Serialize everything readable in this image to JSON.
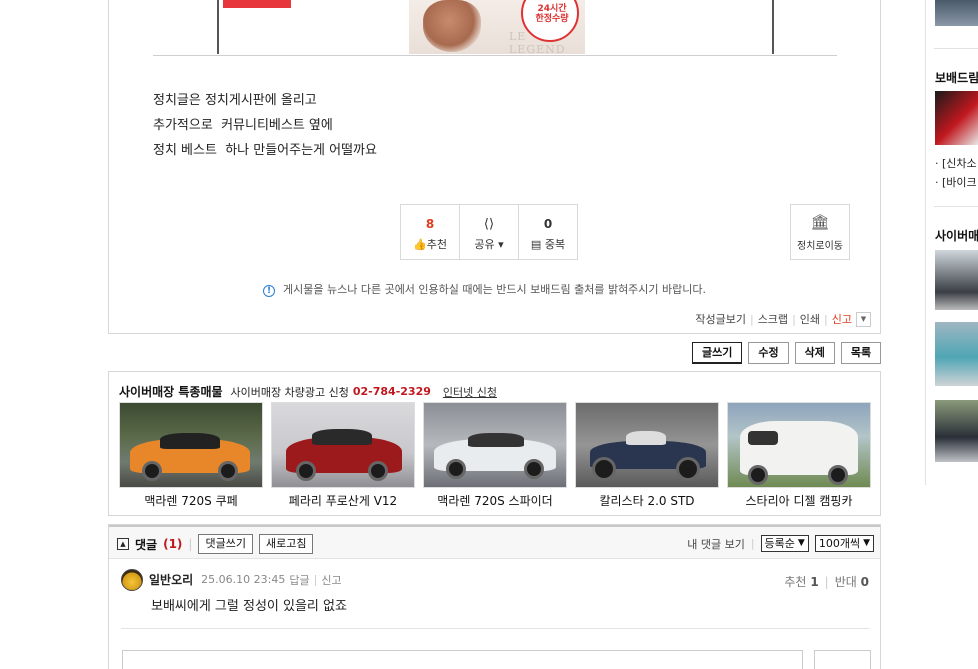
{
  "article": {
    "image_badge_line1": "24시간",
    "image_badge_line2": "한정수량",
    "image_legend_1": "LE",
    "image_legend_2": "LEGEND",
    "lines": [
      "정치글은 정치게시판에 올리고",
      "추가적으로  커뮤니티베스트 옆에",
      "정치 베스트  하나 만들어주는게 어떨까요"
    ],
    "votes": {
      "recommend_count": "8",
      "recommend_label": "추천",
      "share_label": "공유",
      "duplicate_count": "0",
      "duplicate_label": "중복"
    },
    "politics_move_label": "정치로이동",
    "notice": "게시물을 뉴스나 다른 곳에서 인용하실 때에는 반드시 보배드림 출처를 밝혀주시기 바랍니다.",
    "util_links": {
      "my_posts": "작성글보기",
      "scrap": "스크랩",
      "print": "인쇄",
      "report": "신고"
    }
  },
  "write_buttons": {
    "write": "글쓰기",
    "edit": "수정",
    "delete": "삭제",
    "list": "목록"
  },
  "store": {
    "title": "사이버매장 특종매물",
    "subtitle": "사이버매장 차량광고 신청",
    "phone": "02-784-2329",
    "link": "인터넷 신청",
    "items": [
      {
        "name": "맥라렌 720S 쿠페",
        "color": "#e8862a"
      },
      {
        "name": "페라리 푸로산게 V12",
        "color": "#9c1a1c"
      },
      {
        "name": "맥라렌 720S 스파이더",
        "color": "#e9ecef"
      },
      {
        "name": "칼리스타 2.0 STD",
        "color": "#2a3650"
      },
      {
        "name": "스타리아 디젤 캠핑카",
        "color": "#f2f2f0"
      }
    ]
  },
  "comments": {
    "title": "댓글",
    "count": "(1)",
    "write_label": "댓글쓰기",
    "refresh_label": "새로고침",
    "my_comments_label": "내 댓글 보기",
    "sort_select": "등록순",
    "per_page_select": "100개씩",
    "items": [
      {
        "nick": "일반오리",
        "date": "25.06.10 23:45",
        "reply": "답글",
        "report": "신고",
        "text": "보배씨에게 그럴 정성이 있을리 없죠",
        "recommend_label": "추천",
        "recommend_count": "1",
        "oppose_label": "반대",
        "oppose_count": "0"
      }
    ]
  },
  "sidebar": {
    "section1_title": "보배드림",
    "section1_items": [
      "[신차소",
      "[바이크"
    ],
    "section2_title": "사이버매"
  }
}
